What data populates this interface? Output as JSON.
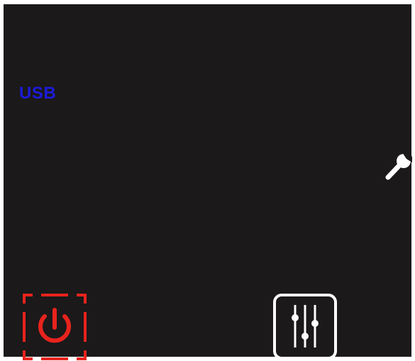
{
  "screen": {
    "source_label": "USB"
  },
  "buttons": {
    "wrench": {
      "icon": "wrench-icon",
      "color": "#ffffff"
    },
    "power": {
      "icon": "power-icon",
      "color": "#e8231d"
    },
    "settings": {
      "icon": "sliders-icon",
      "color": "#ffffff"
    }
  },
  "colors": {
    "background": "#1b191a",
    "source_label": "#1d1bd9",
    "power_accent": "#e8231d"
  }
}
